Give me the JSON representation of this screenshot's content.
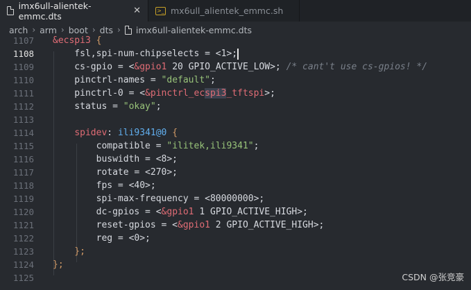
{
  "tabs": [
    {
      "label": "imx6ull-alientek-emmc.dts",
      "icon": "file-icon",
      "close": "✕",
      "active": true
    },
    {
      "label": "mx6ull_alientek_emmc.sh",
      "icon": "terminal-icon",
      "active": false
    }
  ],
  "breadcrumb": {
    "items": [
      "arch",
      "arm",
      "boot",
      "dts"
    ],
    "separator": "›",
    "file": "imx6ull-alientek-emmc.dts"
  },
  "editor": {
    "current_line": "1108",
    "lines": [
      {
        "n": "1107",
        "segs": [
          {
            "t": "&ecspi3",
            "c": "label"
          },
          {
            "t": " {",
            "c": "brace"
          }
        ]
      },
      {
        "n": "1108",
        "segs": [
          {
            "t": "    fsl,spi-num-chipselects = <1>;",
            "c": "plain"
          }
        ]
      },
      {
        "n": "1109",
        "segs": [
          {
            "t": "    cs-gpio = <",
            "c": "plain"
          },
          {
            "t": "&gpio1",
            "c": "ref"
          },
          {
            "t": " 20 GPIO_ACTIVE_LOW>; ",
            "c": "plain"
          },
          {
            "t": "/* cant't use cs-gpios! */",
            "c": "comment"
          }
        ]
      },
      {
        "n": "1110",
        "segs": [
          {
            "t": "    pinctrl-names = ",
            "c": "plain"
          },
          {
            "t": "\"default\"",
            "c": "str"
          },
          {
            "t": ";",
            "c": "plain"
          }
        ]
      },
      {
        "n": "1111",
        "segs": [
          {
            "t": "    pinctrl-0 = <",
            "c": "plain"
          },
          {
            "t": "&pinctrl_ec",
            "c": "ref"
          },
          {
            "t": "spi3",
            "c": "ref-hl"
          },
          {
            "t": "_tftspi",
            "c": "ref"
          },
          {
            "t": ">;",
            "c": "plain"
          }
        ]
      },
      {
        "n": "1112",
        "segs": [
          {
            "t": "    status = ",
            "c": "plain"
          },
          {
            "t": "\"okay\"",
            "c": "str"
          },
          {
            "t": ";",
            "c": "plain"
          }
        ]
      },
      {
        "n": "1113",
        "segs": [
          {
            "t": "",
            "c": "plain"
          }
        ]
      },
      {
        "n": "1114",
        "segs": [
          {
            "t": "    ",
            "c": "plain"
          },
          {
            "t": "spidev",
            "c": "label"
          },
          {
            "t": ": ",
            "c": "plain"
          },
          {
            "t": "ili9341@0",
            "c": "node"
          },
          {
            "t": " {",
            "c": "brace"
          }
        ]
      },
      {
        "n": "1115",
        "segs": [
          {
            "t": "        compatible = ",
            "c": "plain"
          },
          {
            "t": "\"ilitek,ili9341\"",
            "c": "str"
          },
          {
            "t": ";",
            "c": "plain"
          }
        ]
      },
      {
        "n": "1116",
        "segs": [
          {
            "t": "        buswidth = <8>;",
            "c": "plain"
          }
        ]
      },
      {
        "n": "1117",
        "segs": [
          {
            "t": "        rotate = <270>;",
            "c": "plain"
          }
        ]
      },
      {
        "n": "1118",
        "segs": [
          {
            "t": "        fps = <40>;",
            "c": "plain"
          }
        ]
      },
      {
        "n": "1119",
        "segs": [
          {
            "t": "        spi-max-frequency = <80000000>;",
            "c": "plain"
          }
        ]
      },
      {
        "n": "1120",
        "segs": [
          {
            "t": "        dc-gpios = <",
            "c": "plain"
          },
          {
            "t": "&gpio1",
            "c": "ref"
          },
          {
            "t": " 1 GPIO_ACTIVE_HIGH>;",
            "c": "plain"
          }
        ]
      },
      {
        "n": "1121",
        "segs": [
          {
            "t": "        reset-gpios = <",
            "c": "plain"
          },
          {
            "t": "&gpio1",
            "c": "ref"
          },
          {
            "t": " 2 GPIO_ACTIVE_HIGH>;",
            "c": "plain"
          }
        ]
      },
      {
        "n": "1122",
        "segs": [
          {
            "t": "        reg = <0>;",
            "c": "plain"
          }
        ]
      },
      {
        "n": "1123",
        "segs": [
          {
            "t": "    };",
            "c": "brace"
          }
        ]
      },
      {
        "n": "1124",
        "segs": [
          {
            "t": "};",
            "c": "brace"
          }
        ]
      },
      {
        "n": "1125",
        "segs": [
          {
            "t": "",
            "c": "plain"
          }
        ]
      }
    ]
  },
  "watermark": "CSDN @张竞豪",
  "colors": {
    "background": "#272a2f",
    "label": "#e06c75",
    "string": "#98c379",
    "node": "#61afef",
    "comment": "#7a808a"
  }
}
